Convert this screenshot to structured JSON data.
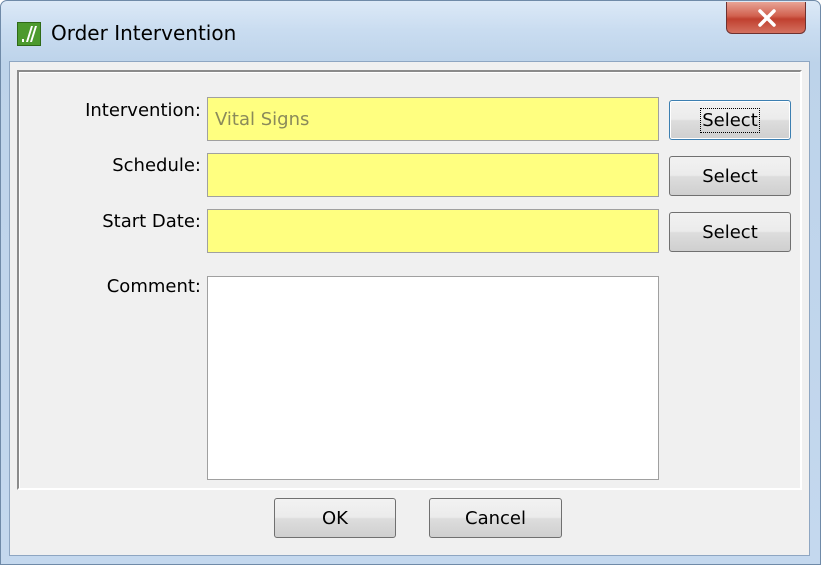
{
  "window": {
    "title": "Order Intervention",
    "close_glyph": "X"
  },
  "form": {
    "intervention_label": "Intervention:",
    "intervention_value": "Vital Signs",
    "schedule_label": "Schedule:",
    "schedule_value": "",
    "start_date_label": "Start Date:",
    "start_date_value": "",
    "comment_label": "Comment:",
    "comment_value": "",
    "select_label": "Select"
  },
  "footer": {
    "ok_label": "OK",
    "cancel_label": "Cancel"
  },
  "icons": {
    "app": "app-logo-icon",
    "close": "close-icon"
  },
  "colors": {
    "required_field": "#ffff80",
    "dialog_background": "#f0f0f0",
    "close_button": "#c9503d",
    "app_icon": "#4d9a2e"
  }
}
